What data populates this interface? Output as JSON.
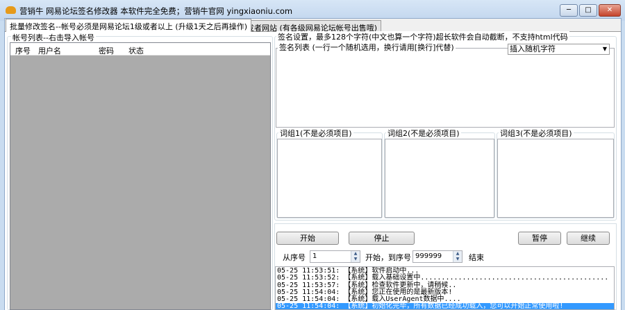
{
  "window": {
    "title": "营销牛 网易论坛签名修改器 本软件完全免费；营销牛官网 yingxiaoniu.com",
    "min": "─",
    "max": "□",
    "close": "✕"
  },
  "tabs": [
    {
      "label": "批量修改签名--帐号必须是网易论坛1级或者以上 (升级1天之后再操作)",
      "active": true
    },
    {
      "label": "开发者网站 (有各级网易论坛帐号出售哦)",
      "active": false
    }
  ],
  "accounts": {
    "group_label": "帐号列表--右击导入帐号",
    "columns": [
      "序号",
      "用户名",
      "密码",
      "状态"
    ]
  },
  "signature": {
    "group_label": "签名设置，最多128个字符(中文也算一个字符)超长软件会自动截断，不支持html代码",
    "list_label": "签名列表 (一行一个随机选用，换行请用[换行]代替)",
    "insert_select": "插入随机字符",
    "word_groups": [
      "词组1(不是必须项目)",
      "词组2(不是必须项目)",
      "词组3(不是必须项目)"
    ]
  },
  "controls": {
    "start": "开始",
    "stop": "停止",
    "pause": "暂停",
    "resume": "继续",
    "from_label": "从序号",
    "from_value": "1",
    "mid_label": "开始，到序号",
    "to_value": "999999",
    "end_label": "结束"
  },
  "log": [
    "05-25 11:53:51: 【系统】软件启动中...",
    "05-25 11:53:52: 【系统】载入基础设置中.............................................",
    "05-25 11:53:57: 【系统】检查软件更新中，请稍候..",
    "05-25 11:54:04: 【系统】您正在使用的是最新版本!",
    "05-25 11:54:04: 【系统】载入UserAgent数据中....",
    "05-25 11:54:04: 【系统】初始化完毕，所有数据已经成功载入，您可以开始正常使用啦!"
  ]
}
